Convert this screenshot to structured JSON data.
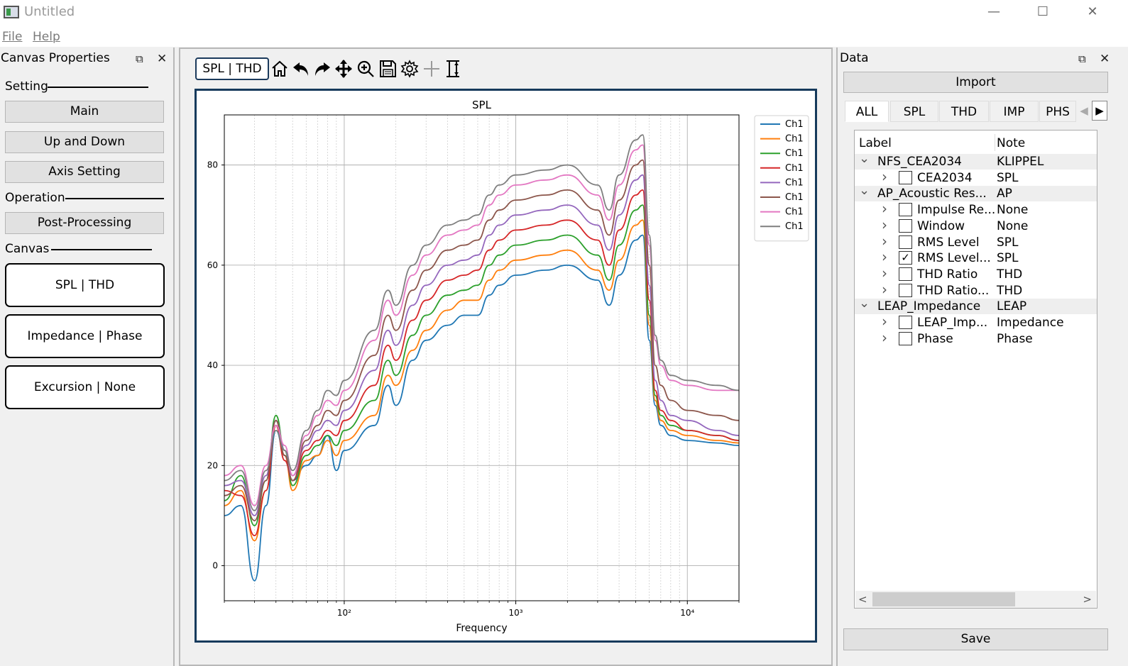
{
  "window": {
    "title": "Untitled",
    "minimize": "—",
    "maximize": "☐",
    "close": "✕"
  },
  "menu": {
    "file": "File",
    "help": "Help"
  },
  "left_dock": {
    "title": "Canvas Properties",
    "setting_label": "Setting",
    "buttons": {
      "main": "Main",
      "up_down": "Up and Down",
      "axis": "Axis Setting"
    },
    "operation_label": "Operation",
    "post_processing": "Post-Processing",
    "canvas_label": "Canvas",
    "canvas_buttons": [
      "SPL | THD",
      "Impedance | Phase",
      "Excursion | None"
    ]
  },
  "center": {
    "active_tab": "SPL | THD",
    "toolbar_icons": [
      "home-icon",
      "undo-icon",
      "redo-icon",
      "pan-icon",
      "zoom-icon",
      "save-icon",
      "settings-icon",
      "crosshair-icon",
      "adjust-icon"
    ]
  },
  "right_dock": {
    "title": "Data",
    "import": "Import",
    "tabs": [
      "ALL",
      "SPL",
      "THD",
      "IMP",
      "PHS"
    ],
    "active_tab": "ALL",
    "columns": {
      "label": "Label",
      "note": "Note"
    },
    "tree": [
      {
        "level": 0,
        "label": "NFS_CEA2034",
        "note": "KLIPPEL",
        "expanded": true
      },
      {
        "level": 1,
        "label": "CEA2034",
        "note": "SPL",
        "checked": false
      },
      {
        "level": 0,
        "label": "AP_Acoustic Res...",
        "note": "AP",
        "expanded": true
      },
      {
        "level": 1,
        "label": "Impulse Re...",
        "note": "None",
        "checked": false
      },
      {
        "level": 1,
        "label": "Window",
        "note": "None",
        "checked": false
      },
      {
        "level": 1,
        "label": "RMS Level",
        "note": "SPL",
        "checked": false
      },
      {
        "level": 1,
        "label": "RMS Level...",
        "note": "SPL",
        "checked": true
      },
      {
        "level": 1,
        "label": "THD Ratio",
        "note": "THD",
        "checked": false
      },
      {
        "level": 1,
        "label": "THD Ratio...",
        "note": "THD",
        "checked": false
      },
      {
        "level": 0,
        "label": "LEAP_Impedance",
        "note": "LEAP",
        "expanded": true
      },
      {
        "level": 1,
        "label": "LEAP_Imp...",
        "note": "Impedance",
        "checked": false
      },
      {
        "level": 1,
        "label": "Phase",
        "note": "Phase",
        "checked": false
      }
    ],
    "save": "Save"
  },
  "chart_data": {
    "type": "line",
    "title": "SPL",
    "xlabel": "Frequency",
    "ylabel": "",
    "x_scale": "log",
    "xlim": [
      20,
      20000
    ],
    "ylim": [
      -7,
      90
    ],
    "x_ticks": [
      100,
      1000,
      10000
    ],
    "x_tick_labels": [
      "10²",
      "10³",
      "10⁴"
    ],
    "y_ticks": [
      0,
      20,
      40,
      60,
      80
    ],
    "grid": true,
    "legend_position": "top-right",
    "x": [
      20,
      25,
      30,
      35,
      40,
      45,
      50,
      60,
      70,
      80,
      90,
      100,
      150,
      180,
      200,
      250,
      300,
      400,
      500,
      600,
      700,
      800,
      1000,
      1500,
      2000,
      3000,
      3500,
      4000,
      5000,
      5500,
      6000,
      6500,
      7000,
      8000,
      10000,
      15000,
      20000
    ],
    "series": [
      {
        "name": "Ch1",
        "color": "#1f77b4",
        "values": [
          10,
          12,
          -3,
          12,
          27,
          22,
          17,
          20,
          22,
          26,
          19,
          23,
          28,
          36,
          32,
          41,
          45,
          48,
          50,
          50,
          54,
          56,
          58,
          59,
          60,
          57,
          52,
          58,
          65,
          66,
          45,
          32,
          28,
          26,
          25,
          24.5,
          24
        ]
      },
      {
        "name": "Ch1",
        "color": "#ff7f0e",
        "values": [
          12,
          15,
          5,
          15,
          28,
          22,
          15,
          21,
          22,
          25,
          22,
          25,
          30,
          38,
          36,
          43,
          47,
          51,
          53,
          53,
          57,
          59,
          61,
          62,
          63,
          59,
          55,
          61,
          68,
          69,
          48,
          33,
          29,
          27,
          26,
          25,
          24.5
        ]
      },
      {
        "name": "Ch1",
        "color": "#2ca02c",
        "values": [
          13,
          18,
          8,
          17,
          30,
          23,
          16,
          22,
          24,
          26,
          24,
          27,
          33,
          41,
          38,
          46,
          50,
          54,
          55,
          56,
          60,
          62,
          64,
          65,
          66,
          62,
          57,
          64,
          71,
          72,
          50,
          34,
          30,
          28,
          27,
          26,
          25
        ]
      },
      {
        "name": "Ch1",
        "color": "#d62728",
        "values": [
          15,
          14,
          6,
          15,
          28,
          21,
          17,
          23,
          25,
          27,
          26,
          29,
          36,
          44,
          41,
          49,
          53,
          57,
          58,
          59,
          63,
          65,
          67,
          68,
          69,
          65,
          60,
          67,
          74,
          75,
          53,
          35,
          31,
          29,
          27,
          26,
          25
        ]
      },
      {
        "name": "Ch1",
        "color": "#9467bd",
        "values": [
          16,
          17,
          10,
          18,
          29,
          23,
          18,
          24,
          27,
          29,
          28,
          31,
          39,
          47,
          44,
          52,
          56,
          60,
          61,
          62,
          66,
          68,
          70,
          71,
          72,
          68,
          63,
          70,
          77,
          78,
          56,
          37,
          33,
          30,
          29,
          27,
          26
        ]
      },
      {
        "name": "Ch1",
        "color": "#8c564b",
        "values": [
          14,
          16,
          9,
          17,
          29,
          22,
          17,
          25,
          28,
          31,
          30,
          33,
          42,
          50,
          47,
          55,
          59,
          63,
          64,
          65,
          69,
          71,
          73,
          74,
          75,
          71,
          66,
          73,
          80,
          81,
          60,
          40,
          36,
          33,
          31,
          30,
          29
        ]
      },
      {
        "name": "Ch1",
        "color": "#e377c2",
        "values": [
          18,
          20,
          12,
          20,
          28,
          24,
          18,
          26,
          30,
          33,
          32,
          35,
          45,
          53,
          50,
          58,
          62,
          66,
          67,
          68,
          72,
          74,
          76,
          77,
          78,
          74,
          69,
          76,
          83,
          84,
          64,
          45,
          40,
          37,
          36,
          35,
          35
        ]
      },
      {
        "name": "Ch1",
        "color": "#7f7f7f",
        "values": [
          17,
          19,
          11,
          19,
          27,
          23,
          19,
          27,
          31,
          35,
          34,
          37,
          47,
          55,
          52,
          60,
          64,
          68,
          69,
          70,
          74,
          76,
          78,
          79,
          80,
          76,
          71,
          78,
          85,
          86,
          66,
          46,
          41,
          38,
          37,
          36,
          35
        ]
      }
    ]
  }
}
